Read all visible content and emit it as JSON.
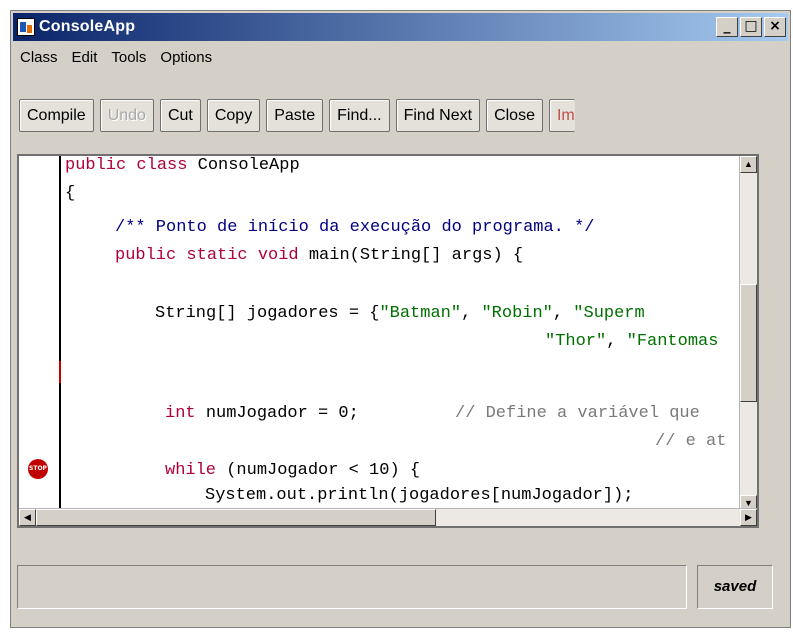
{
  "window": {
    "title": "ConsoleApp",
    "minimize_glyph": "_",
    "maximize_glyph": "□",
    "close_glyph": "×"
  },
  "menu": [
    "Class",
    "Edit",
    "Tools",
    "Options"
  ],
  "toolbar": {
    "compile": "Compile",
    "undo": "Undo",
    "cut": "Cut",
    "copy": "Copy",
    "paste": "Paste",
    "find": "Find...",
    "find_next": "Find Next",
    "close": "Close",
    "implementation_partial": "Im"
  },
  "editor": {
    "breakpoint_label": "STOP",
    "lines": {
      "l1_kw": "public class ",
      "l1_rest": "ConsoleApp",
      "l2": "{",
      "l3_comment": "/** Ponto de início da execução do programa. */",
      "l4_kw": "public static void ",
      "l4_rest": "main(String[] args) {",
      "l5_pre": "String[] jogadores = {",
      "l5_s1": "\"Batman\"",
      "l5_sep1": ", ",
      "l5_s2": "\"Robin\"",
      "l5_sep2": ", ",
      "l5_s3": "\"Superm",
      "l6_s1": "\"Thor\"",
      "l6_sep": ", ",
      "l6_s2": "\"Fantomas",
      "l7_kw": "int ",
      "l7_rest": "numJogador = 0;",
      "l7_comment": "// Define a variável que",
      "l8_comment": "// e at",
      "l9_kw": "while ",
      "l9_rest": "(numJogador < 10) {",
      "l10": "System.out.println(jogadores[numJogador]);",
      "l11": "}"
    }
  },
  "scroll": {
    "up": "▲",
    "down": "▼",
    "left": "◀",
    "right": "▶"
  },
  "status": {
    "message": "",
    "saved_label": "saved"
  },
  "colors": {
    "keyword": "#b0003a",
    "string": "#007000",
    "comment": "#000080",
    "breakpoint": "#c00000",
    "titlebar_start": "#0a246a"
  }
}
